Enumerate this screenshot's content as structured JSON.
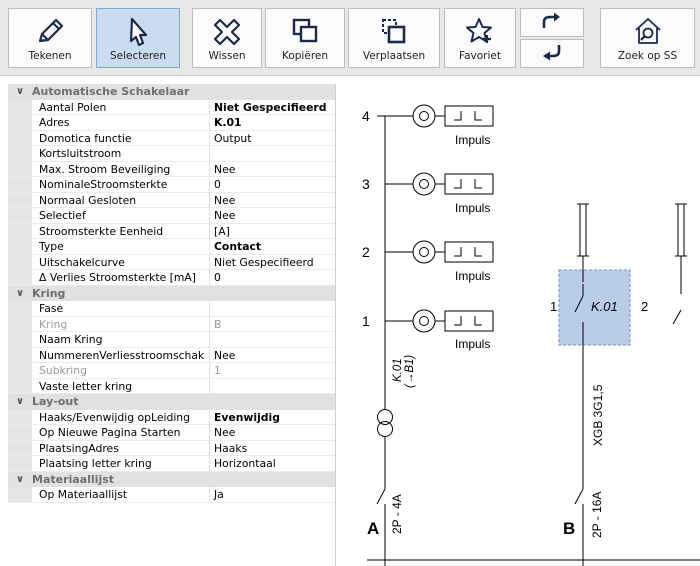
{
  "toolbar": {
    "buttons": [
      {
        "label": "Tekenen",
        "icon": "pencil-icon",
        "active": false
      },
      {
        "label": "Selecteren",
        "icon": "cursor-icon",
        "active": true
      },
      {
        "label": "Wissen",
        "icon": "erase-x-icon",
        "active": false
      },
      {
        "label": "Kopiëren",
        "icon": "copy-icon",
        "active": false
      },
      {
        "label": "Verplaatsen",
        "icon": "move-icon",
        "active": false
      },
      {
        "label": "Favoriet",
        "icon": "star-plus-icon",
        "active": false
      },
      {
        "label": "Zoek op SS",
        "icon": "house-search-icon",
        "active": false
      }
    ],
    "small_buttons": [
      {
        "icon": "redo-arrow-icon"
      },
      {
        "icon": "undo-arrow-icon"
      }
    ],
    "colors": {
      "active_bg": "#c9dcf2",
      "icon_navy": "#1b2a4a"
    }
  },
  "properties": {
    "categories": [
      {
        "title": "Automatische Schakelaar",
        "rows": [
          {
            "name": "Aantal Polen",
            "value": "Niet Gespecifieerd",
            "bold": true,
            "disabled": false
          },
          {
            "name": "Adres",
            "value": "K.01",
            "bold": true,
            "disabled": false
          },
          {
            "name": "Domotica functie",
            "value": "Output",
            "bold": false,
            "disabled": false
          },
          {
            "name": "Kortsluitstroom",
            "value": "",
            "bold": false,
            "disabled": false
          },
          {
            "name": "Max. Stroom Beveiliging",
            "value": "Nee",
            "bold": false,
            "disabled": false
          },
          {
            "name": "NominaleStroomsterkte",
            "value": "0",
            "bold": false,
            "disabled": false
          },
          {
            "name": "Normaal Gesloten",
            "value": "Nee",
            "bold": false,
            "disabled": false
          },
          {
            "name": "Selectief",
            "value": "Nee",
            "bold": false,
            "disabled": false
          },
          {
            "name": "Stroomsterkte Eenheid",
            "value": "[A]",
            "bold": false,
            "disabled": false
          },
          {
            "name": "Type",
            "value": "Contact",
            "bold": true,
            "disabled": false
          },
          {
            "name": "Uitschakelcurve",
            "value": "Niet Gespecifieerd",
            "bold": false,
            "disabled": false
          },
          {
            "name": "Δ Verlies Stroomsterkte [mA]",
            "value": "0",
            "bold": false,
            "disabled": false
          }
        ]
      },
      {
        "title": "Kring",
        "rows": [
          {
            "name": "Fase",
            "value": "",
            "bold": false,
            "disabled": false
          },
          {
            "name": "Kring",
            "value": "B",
            "bold": false,
            "disabled": true
          },
          {
            "name": "Naam Kring",
            "value": "",
            "bold": false,
            "disabled": false
          },
          {
            "name": "NummerenVerliesstroomschak",
            "value": "Nee",
            "bold": false,
            "disabled": false
          },
          {
            "name": "Subkring",
            "value": "1",
            "bold": false,
            "disabled": true
          },
          {
            "name": "Vaste letter kring",
            "value": "",
            "bold": false,
            "disabled": false
          }
        ]
      },
      {
        "title": "Lay-out",
        "rows": [
          {
            "name": "Haaks/Evenwijdig opLeiding",
            "value": "Evenwijdig",
            "bold": true,
            "disabled": false
          },
          {
            "name": "Op Nieuwe Pagina Starten",
            "value": "Nee",
            "bold": false,
            "disabled": false
          },
          {
            "name": "PlaatsingAdres",
            "value": "Haaks",
            "bold": false,
            "disabled": false
          },
          {
            "name": "Plaatsing letter kring",
            "value": "Horizontaal",
            "bold": false,
            "disabled": false
          }
        ]
      },
      {
        "title": "Materiaallijst",
        "rows": [
          {
            "name": "Op Materiaallijst",
            "value": "Ja",
            "bold": false,
            "disabled": false
          }
        ]
      }
    ]
  },
  "diagram": {
    "pushbuttons": [
      {
        "number": "4",
        "label": "Impuls"
      },
      {
        "number": "3",
        "label": "Impuls"
      },
      {
        "number": "2",
        "label": "Impuls"
      },
      {
        "number": "1",
        "label": "Impuls"
      }
    ],
    "relay_label_line1": "K.01",
    "relay_label_line2": "(→B1)",
    "contact": {
      "left_num": "1",
      "address": "K.01",
      "right_num": "2"
    },
    "cable": "XGB 3G1,5",
    "circuit_a": {
      "letter": "A",
      "breaker": "2P - 4A"
    },
    "circuit_b": {
      "letter": "B",
      "breaker": "2P - 16A"
    },
    "selection_color": "#b9cde8"
  }
}
